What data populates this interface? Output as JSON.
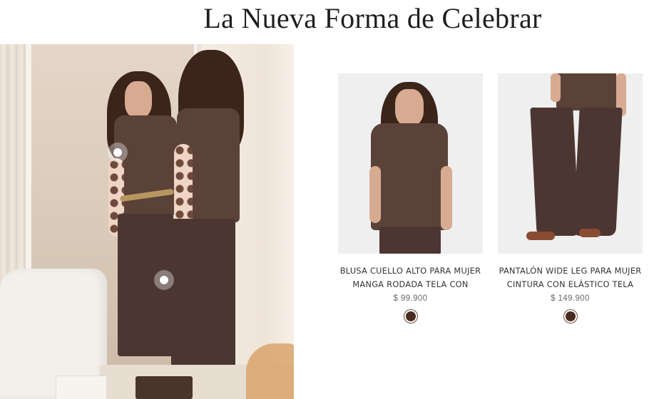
{
  "section": {
    "title": "La Nueva Forma de Celebrar"
  },
  "lifestyle": {
    "hotspots": [
      {
        "id": "hotspot-blouse"
      },
      {
        "id": "hotspot-pants"
      }
    ]
  },
  "products": [
    {
      "name": "BLUSA CUELLO ALTO PARA MUJER MANGA RODADA TELA CON EFECTO",
      "price": "$ 99.900",
      "swatch_color": "#4a2b1f"
    },
    {
      "name": "PANTALÓN WIDE LEG PARA MUJER CINTURA CON ELÁSTICO TELA CON...",
      "price": "$ 149.900",
      "swatch_color": "#4a2b1f"
    }
  ]
}
